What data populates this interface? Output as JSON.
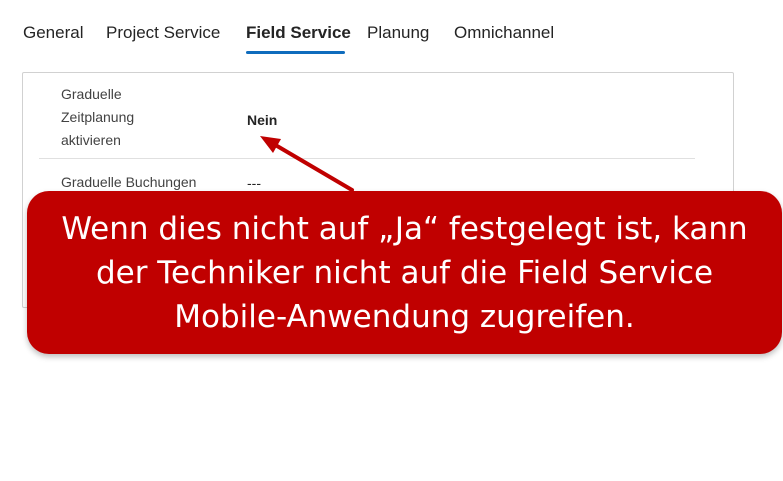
{
  "tabs": [
    {
      "label": "General"
    },
    {
      "label": "Project Service"
    },
    {
      "label": "Field Service",
      "active": true
    },
    {
      "label": "Planung"
    },
    {
      "label": "Omnichannel"
    }
  ],
  "fields": [
    {
      "label": "Graduelle Zeitplanung aktivieren",
      "value": "Nein"
    },
    {
      "label": "Graduelle Buchungen",
      "value": "---"
    }
  ],
  "callout": {
    "text": "Wenn dies nicht auf „Ja“ festgelegt ist, kann der Techniker nicht auf die Field Service Mobile-Anwendung zugreifen."
  },
  "colors": {
    "accent": "#0f6cbd",
    "callout_bg": "#c00000",
    "arrow": "#c00000"
  }
}
